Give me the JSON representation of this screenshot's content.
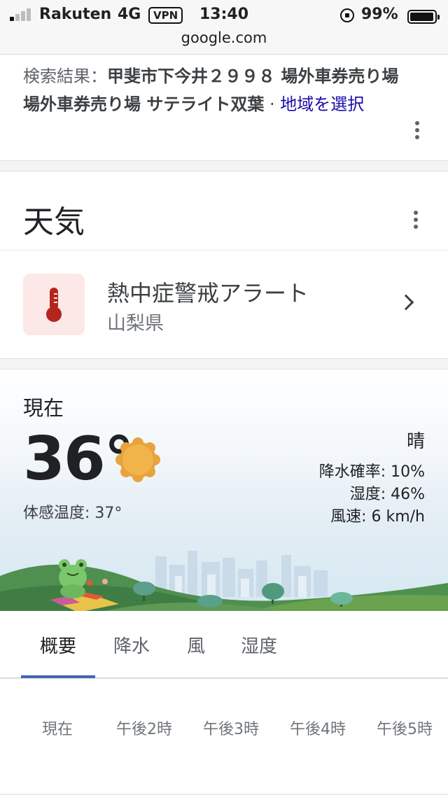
{
  "status_bar": {
    "carrier": "Rakuten",
    "network": "4G",
    "vpn": "VPN",
    "time": "13:40",
    "battery": "99%",
    "battery_level": 0.99,
    "signal_bars": 1,
    "url": "google.com"
  },
  "snippet": {
    "prefix": "検索結果：",
    "query": "甲斐市下今井２９９８ 場外車券売り場 場外車券売り場 サテライト双葉",
    "separator": " · ",
    "link": "地域を選択",
    "link_color": "#1a0dab"
  },
  "weather": {
    "title": "天気",
    "alert": {
      "title": "熱中症警戒アラート",
      "region": "山梨県",
      "icon": "thermometer-icon",
      "accent": "#c5221f"
    },
    "current": {
      "label": "現在",
      "temperature": "36°",
      "feels_like": "体感温度: 37°",
      "condition": "晴",
      "precipitation": "降水確率: 10%",
      "humidity": "湿度: 46%",
      "wind": "風速: 6 km/h",
      "icon": "sun-icon"
    },
    "tabs": [
      {
        "label": "概要",
        "active": true
      },
      {
        "label": "降水",
        "active": false
      },
      {
        "label": "風",
        "active": false
      },
      {
        "label": "湿度",
        "active": false
      }
    ],
    "hours": [
      "現在",
      "午後2時",
      "午後3時",
      "午後4時",
      "午後5時"
    ]
  }
}
